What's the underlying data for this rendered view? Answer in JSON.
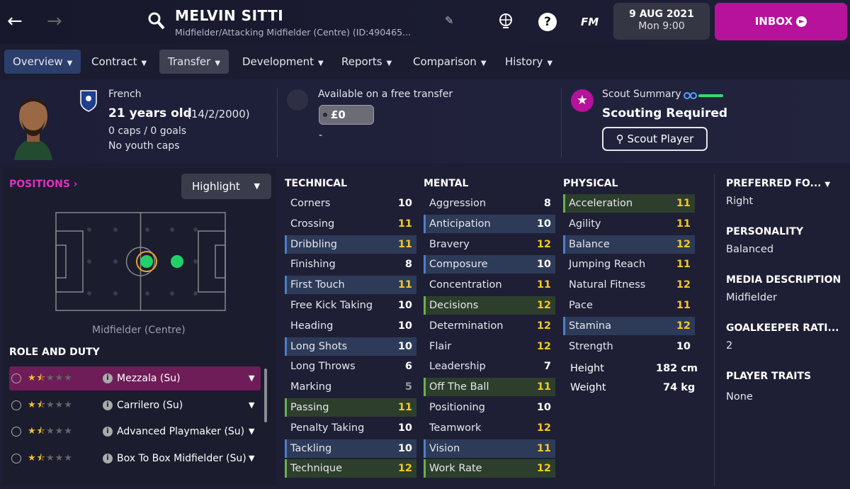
{
  "header": {
    "player_name": "MELVIN SITTI",
    "subtitle": "Midfielder/Attacking Midfielder (Centre) (ID:490465...",
    "date": "9 AUG 2021",
    "time": "Mon 9:00",
    "inbox_label": "INBOX",
    "fm_label": "FM",
    "help_label": "?"
  },
  "tabs": [
    {
      "label": "Overview"
    },
    {
      "label": "Contract"
    },
    {
      "label": "Transfer"
    },
    {
      "label": "Development"
    },
    {
      "label": "Reports"
    },
    {
      "label": "Comparison"
    },
    {
      "label": "History"
    }
  ],
  "profile": {
    "nationality": "French",
    "age": "21 years old",
    "dob": "(14/2/2000)",
    "caps": "0 caps / 0 goals",
    "youth": "No youth caps"
  },
  "transfer": {
    "status": "Available on a free transfer",
    "value": "£0",
    "dash": "-"
  },
  "scout": {
    "label": "Scout Summary",
    "status": "Scouting Required",
    "button": "Scout Player"
  },
  "positions": {
    "link": "POSITIONS",
    "highlight": "Highlight",
    "position_label": "Midfielder (Centre)"
  },
  "role_duty": {
    "heading": "ROLE AND DUTY",
    "roles": [
      {
        "name": "Mezzala (Su)",
        "stars": 1.5
      },
      {
        "name": "Carrilero (Su)",
        "stars": 1.5
      },
      {
        "name": "Advanced Playmaker (Su)",
        "stars": 1.5
      },
      {
        "name": "Box To Box Midfielder (Su)",
        "stars": 1.5
      }
    ]
  },
  "technical": {
    "heading": "TECHNICAL",
    "attrs": [
      {
        "name": "Corners",
        "value": "10"
      },
      {
        "name": "Crossing",
        "value": "11"
      },
      {
        "name": "Dribbling",
        "value": "11"
      },
      {
        "name": "Finishing",
        "value": "8"
      },
      {
        "name": "First Touch",
        "value": "11"
      },
      {
        "name": "Free Kick Taking",
        "value": "10"
      },
      {
        "name": "Heading",
        "value": "10"
      },
      {
        "name": "Long Shots",
        "value": "10"
      },
      {
        "name": "Long Throws",
        "value": "6"
      },
      {
        "name": "Marking",
        "value": "5"
      },
      {
        "name": "Passing",
        "value": "11"
      },
      {
        "name": "Penalty Taking",
        "value": "10"
      },
      {
        "name": "Tackling",
        "value": "10"
      },
      {
        "name": "Technique",
        "value": "12"
      }
    ]
  },
  "mental": {
    "heading": "MENTAL",
    "attrs": [
      {
        "name": "Aggression",
        "value": "8"
      },
      {
        "name": "Anticipation",
        "value": "10"
      },
      {
        "name": "Bravery",
        "value": "12"
      },
      {
        "name": "Composure",
        "value": "10"
      },
      {
        "name": "Concentration",
        "value": "11"
      },
      {
        "name": "Decisions",
        "value": "12"
      },
      {
        "name": "Determination",
        "value": "12"
      },
      {
        "name": "Flair",
        "value": "12"
      },
      {
        "name": "Leadership",
        "value": "7"
      },
      {
        "name": "Off The Ball",
        "value": "11"
      },
      {
        "name": "Positioning",
        "value": "10"
      },
      {
        "name": "Teamwork",
        "value": "12"
      },
      {
        "name": "Vision",
        "value": "11"
      },
      {
        "name": "Work Rate",
        "value": "12"
      }
    ]
  },
  "physical": {
    "heading": "PHYSICAL",
    "attrs": [
      {
        "name": "Acceleration",
        "value": "11"
      },
      {
        "name": "Agility",
        "value": "11"
      },
      {
        "name": "Balance",
        "value": "12"
      },
      {
        "name": "Jumping Reach",
        "value": "11"
      },
      {
        "name": "Natural Fitness",
        "value": "12"
      },
      {
        "name": "Pace",
        "value": "11"
      },
      {
        "name": "Stamina",
        "value": "12"
      },
      {
        "name": "Strength",
        "value": "10"
      }
    ],
    "height_label": "Height",
    "height": "182 cm",
    "weight_label": "Weight",
    "weight": "74 kg"
  },
  "details": {
    "pref_foot_label": "PREFERRED FO...",
    "pref_foot": "Right",
    "personality_label": "PERSONALITY",
    "personality": "Balanced",
    "media_label": "MEDIA DESCRIPTION",
    "media": "Midfielder",
    "gk_label": "GOALKEEPER RATI...",
    "gk": "2",
    "traits_label": "PLAYER TRAITS",
    "traits": "None"
  },
  "colors": {
    "accent": "#b6129c",
    "highlight_yellow": "#f4c825"
  }
}
